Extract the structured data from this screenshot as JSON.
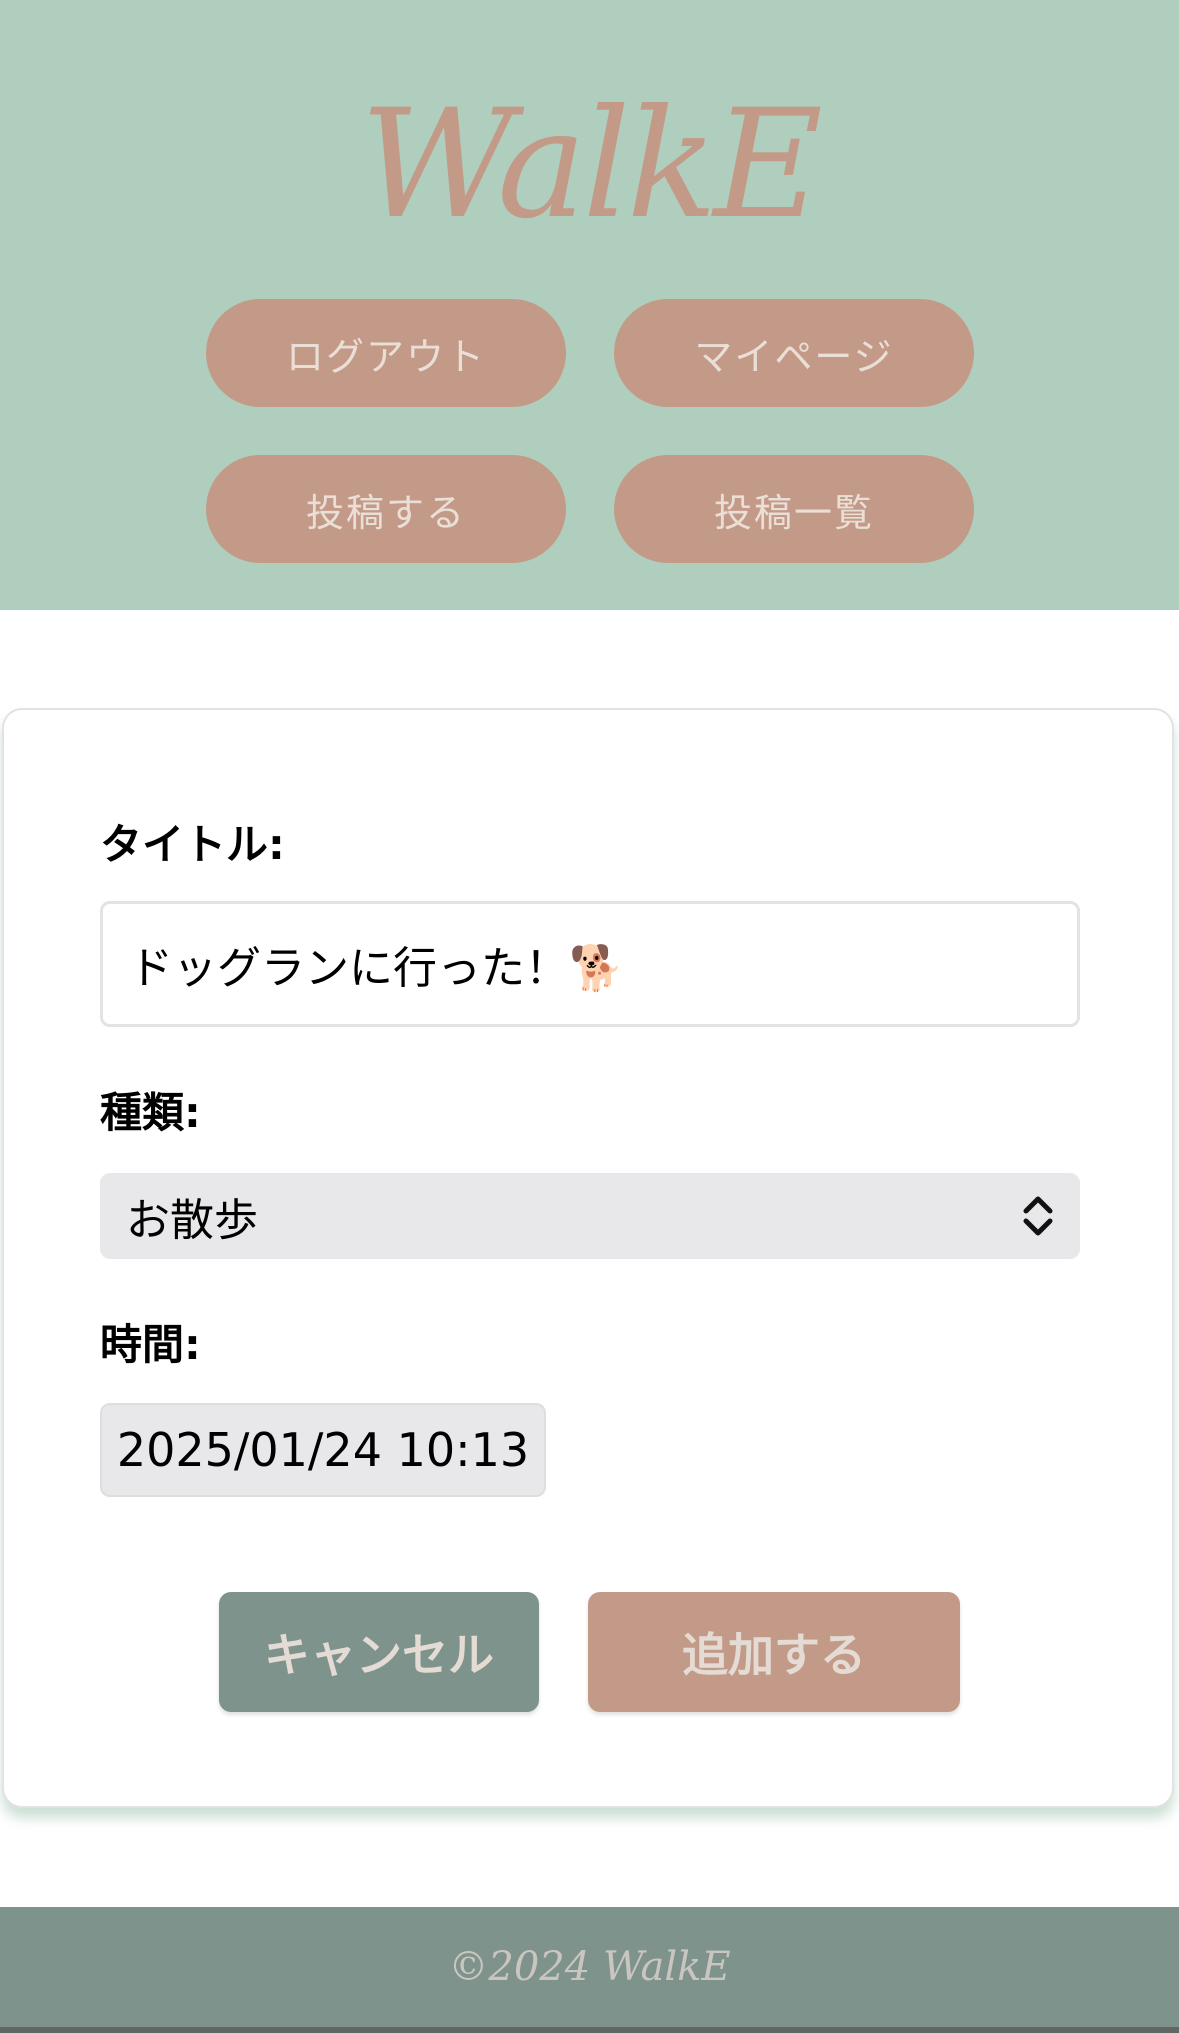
{
  "header": {
    "logo": "WalkE",
    "nav": {
      "logout": "ログアウト",
      "mypage": "マイページ",
      "post": "投稿する",
      "post_list": "投稿一覧"
    }
  },
  "form": {
    "title_label": "タイトル:",
    "title_value": "ドッグランに行った！🐕",
    "type_label": "種類:",
    "type_selected": "お散歩",
    "time_label": "時間:",
    "time_value": "2025/01/24 10:13",
    "cancel_label": "キャンセル",
    "submit_label": "追加する"
  },
  "footer": {
    "copyright": "©2024 WalkE"
  },
  "colors": {
    "header_bg": "#b0cebd",
    "accent": "#c39a88",
    "footer_bg": "#7d938c",
    "cancel_bg": "#7d938c"
  },
  "icons": {
    "select": "up-down-chevron-icon"
  }
}
